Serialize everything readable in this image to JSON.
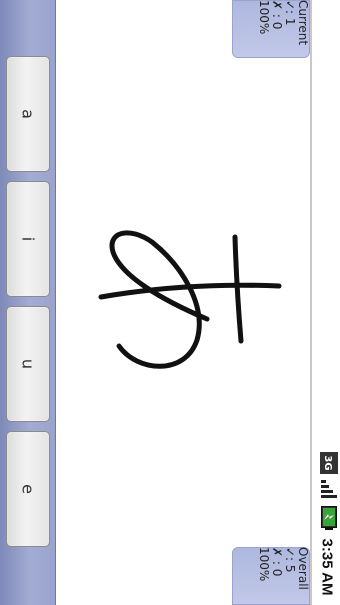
{
  "answers": [
    {
      "label": "a"
    },
    {
      "label": "i"
    },
    {
      "label": "u"
    },
    {
      "label": "e"
    }
  ],
  "score_current": {
    "title": "Current",
    "correct": "✓: 1",
    "wrong": "✗ : 0",
    "percent": "100%"
  },
  "score_overall": {
    "title": "Overall",
    "correct": "✓: 5",
    "wrong": "✗ : 0",
    "percent": "100%"
  },
  "status": {
    "network_label": "3G",
    "time": "3:35 AM"
  },
  "colors": {
    "panel": "#a3acd3",
    "score_box": "#c1c8e8",
    "ink": "#111111"
  }
}
